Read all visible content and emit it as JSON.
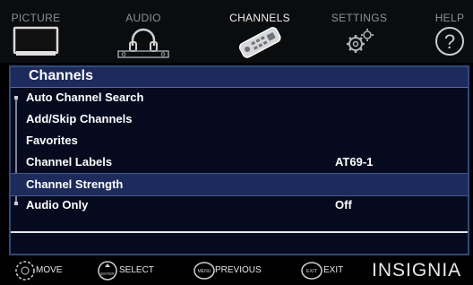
{
  "tabs": [
    {
      "label": "PICTURE",
      "icon": "tv-icon"
    },
    {
      "label": "AUDIO",
      "icon": "headphones-icon"
    },
    {
      "label": "CHANNELS",
      "icon": "remote-control-icon",
      "active": true
    },
    {
      "label": "SETTINGS",
      "icon": "gears-icon"
    },
    {
      "label": "HELP",
      "icon": "question-icon"
    }
  ],
  "panel": {
    "title": "Channels",
    "items": [
      {
        "label": "Auto Channel Search",
        "value": ""
      },
      {
        "label": "Add/Skip Channels",
        "value": ""
      },
      {
        "label": "Favorites",
        "value": ""
      },
      {
        "label": "Channel Labels",
        "value": "AT69-1"
      },
      {
        "label": "Channel Strength",
        "value": "",
        "selected": true
      },
      {
        "label": "Audio Only",
        "value": "Off"
      }
    ]
  },
  "footer": {
    "move": "MOVE",
    "enter_key": "ENTER",
    "select": "SELECT",
    "menu_key": "MENU",
    "previous": "PREVIOUS",
    "exit_key": "EXIT",
    "exit": "EXIT",
    "brand": "INSIGNIA"
  },
  "colors": {
    "panel_bg": "#050a1e",
    "highlight": "#1c2b5c",
    "border": "#2e4a7c"
  }
}
